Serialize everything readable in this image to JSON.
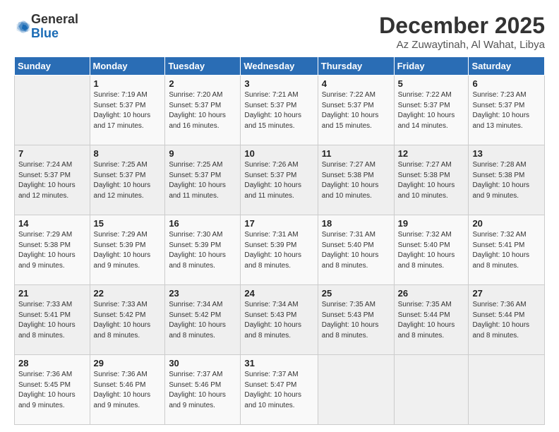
{
  "logo": {
    "general": "General",
    "blue": "Blue"
  },
  "title": "December 2025",
  "location": "Az Zuwaytinah, Al Wahat, Libya",
  "days_header": [
    "Sunday",
    "Monday",
    "Tuesday",
    "Wednesday",
    "Thursday",
    "Friday",
    "Saturday"
  ],
  "weeks": [
    [
      {
        "day": "",
        "info": ""
      },
      {
        "day": "1",
        "info": "Sunrise: 7:19 AM\nSunset: 5:37 PM\nDaylight: 10 hours\nand 17 minutes."
      },
      {
        "day": "2",
        "info": "Sunrise: 7:20 AM\nSunset: 5:37 PM\nDaylight: 10 hours\nand 16 minutes."
      },
      {
        "day": "3",
        "info": "Sunrise: 7:21 AM\nSunset: 5:37 PM\nDaylight: 10 hours\nand 15 minutes."
      },
      {
        "day": "4",
        "info": "Sunrise: 7:22 AM\nSunset: 5:37 PM\nDaylight: 10 hours\nand 15 minutes."
      },
      {
        "day": "5",
        "info": "Sunrise: 7:22 AM\nSunset: 5:37 PM\nDaylight: 10 hours\nand 14 minutes."
      },
      {
        "day": "6",
        "info": "Sunrise: 7:23 AM\nSunset: 5:37 PM\nDaylight: 10 hours\nand 13 minutes."
      }
    ],
    [
      {
        "day": "7",
        "info": "Sunrise: 7:24 AM\nSunset: 5:37 PM\nDaylight: 10 hours\nand 12 minutes."
      },
      {
        "day": "8",
        "info": "Sunrise: 7:25 AM\nSunset: 5:37 PM\nDaylight: 10 hours\nand 12 minutes."
      },
      {
        "day": "9",
        "info": "Sunrise: 7:25 AM\nSunset: 5:37 PM\nDaylight: 10 hours\nand 11 minutes."
      },
      {
        "day": "10",
        "info": "Sunrise: 7:26 AM\nSunset: 5:37 PM\nDaylight: 10 hours\nand 11 minutes."
      },
      {
        "day": "11",
        "info": "Sunrise: 7:27 AM\nSunset: 5:38 PM\nDaylight: 10 hours\nand 10 minutes."
      },
      {
        "day": "12",
        "info": "Sunrise: 7:27 AM\nSunset: 5:38 PM\nDaylight: 10 hours\nand 10 minutes."
      },
      {
        "day": "13",
        "info": "Sunrise: 7:28 AM\nSunset: 5:38 PM\nDaylight: 10 hours\nand 9 minutes."
      }
    ],
    [
      {
        "day": "14",
        "info": "Sunrise: 7:29 AM\nSunset: 5:38 PM\nDaylight: 10 hours\nand 9 minutes."
      },
      {
        "day": "15",
        "info": "Sunrise: 7:29 AM\nSunset: 5:39 PM\nDaylight: 10 hours\nand 9 minutes."
      },
      {
        "day": "16",
        "info": "Sunrise: 7:30 AM\nSunset: 5:39 PM\nDaylight: 10 hours\nand 8 minutes."
      },
      {
        "day": "17",
        "info": "Sunrise: 7:31 AM\nSunset: 5:39 PM\nDaylight: 10 hours\nand 8 minutes."
      },
      {
        "day": "18",
        "info": "Sunrise: 7:31 AM\nSunset: 5:40 PM\nDaylight: 10 hours\nand 8 minutes."
      },
      {
        "day": "19",
        "info": "Sunrise: 7:32 AM\nSunset: 5:40 PM\nDaylight: 10 hours\nand 8 minutes."
      },
      {
        "day": "20",
        "info": "Sunrise: 7:32 AM\nSunset: 5:41 PM\nDaylight: 10 hours\nand 8 minutes."
      }
    ],
    [
      {
        "day": "21",
        "info": "Sunrise: 7:33 AM\nSunset: 5:41 PM\nDaylight: 10 hours\nand 8 minutes."
      },
      {
        "day": "22",
        "info": "Sunrise: 7:33 AM\nSunset: 5:42 PM\nDaylight: 10 hours\nand 8 minutes."
      },
      {
        "day": "23",
        "info": "Sunrise: 7:34 AM\nSunset: 5:42 PM\nDaylight: 10 hours\nand 8 minutes."
      },
      {
        "day": "24",
        "info": "Sunrise: 7:34 AM\nSunset: 5:43 PM\nDaylight: 10 hours\nand 8 minutes."
      },
      {
        "day": "25",
        "info": "Sunrise: 7:35 AM\nSunset: 5:43 PM\nDaylight: 10 hours\nand 8 minutes."
      },
      {
        "day": "26",
        "info": "Sunrise: 7:35 AM\nSunset: 5:44 PM\nDaylight: 10 hours\nand 8 minutes."
      },
      {
        "day": "27",
        "info": "Sunrise: 7:36 AM\nSunset: 5:44 PM\nDaylight: 10 hours\nand 8 minutes."
      }
    ],
    [
      {
        "day": "28",
        "info": "Sunrise: 7:36 AM\nSunset: 5:45 PM\nDaylight: 10 hours\nand 9 minutes."
      },
      {
        "day": "29",
        "info": "Sunrise: 7:36 AM\nSunset: 5:46 PM\nDaylight: 10 hours\nand 9 minutes."
      },
      {
        "day": "30",
        "info": "Sunrise: 7:37 AM\nSunset: 5:46 PM\nDaylight: 10 hours\nand 9 minutes."
      },
      {
        "day": "31",
        "info": "Sunrise: 7:37 AM\nSunset: 5:47 PM\nDaylight: 10 hours\nand 10 minutes."
      },
      {
        "day": "",
        "info": ""
      },
      {
        "day": "",
        "info": ""
      },
      {
        "day": "",
        "info": ""
      }
    ]
  ]
}
